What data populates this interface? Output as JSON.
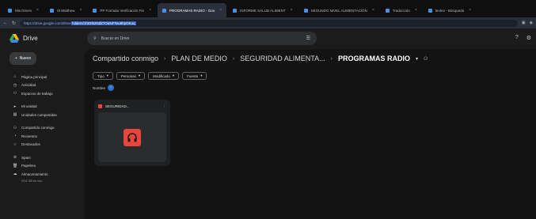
{
  "browser": {
    "tabs": [
      {
        "label": "Mis Drives",
        "active": false
      },
      {
        "label": "St Matthew",
        "active": false
      },
      {
        "label": "PP Formato Verificación Fin",
        "active": false
      },
      {
        "label": "PROGRAMAS RADIO - Goo",
        "active": true
      },
      {
        "label": "INFORME SALUD ALIMENT",
        "active": false
      },
      {
        "label": "SEGUNDO NIVEL ALIMENTACIÓN",
        "active": false
      },
      {
        "label": "Traducción",
        "active": false
      },
      {
        "label": "lentes - Búsqueda",
        "active": false
      }
    ],
    "url_host": "https://drive.google.com/drive/",
    "url_path": "folders/1hD0k2NdZ7OaNFTeu8hpOKoq"
  },
  "app": {
    "logo_text": "Drive",
    "search_placeholder": "Buscar en Drive"
  },
  "sidebar": {
    "new_label": "Nuevo",
    "group1": [
      {
        "icon": "⌂",
        "label": "Página principal"
      },
      {
        "icon": "◷",
        "label": "Actividad"
      },
      {
        "icon": "⚇",
        "label": "Espacios de trabajo"
      }
    ],
    "group2": [
      {
        "icon": "▸",
        "label": "Mi unidad"
      },
      {
        "icon": "▤",
        "label": "Unidades compartidas"
      }
    ],
    "group3": [
      {
        "icon": "⚇",
        "label": "Compartido conmigo"
      },
      {
        "icon": "◔",
        "label": "Recientes"
      },
      {
        "icon": "☆",
        "label": "Destacados"
      }
    ],
    "group4": [
      {
        "icon": "⊘",
        "label": "Spam"
      },
      {
        "icon": "🗑",
        "label": "Papelera"
      },
      {
        "icon": "☁",
        "label": "Almacenamiento"
      }
    ],
    "storage_text": "29,8 GB en uso"
  },
  "breadcrumb": [
    "Compartido conmigo",
    "PLAN DE MEDIO",
    "SEGURIDAD ALIMENTA...",
    "PROGRAMAS RADIO"
  ],
  "filters": [
    {
      "label": "Tipo"
    },
    {
      "label": "Personas"
    },
    {
      "label": "Modificado"
    },
    {
      "label": "Fuente"
    }
  ],
  "sort_label": "Nombre",
  "file": {
    "name": "SEGURIDAD..."
  }
}
